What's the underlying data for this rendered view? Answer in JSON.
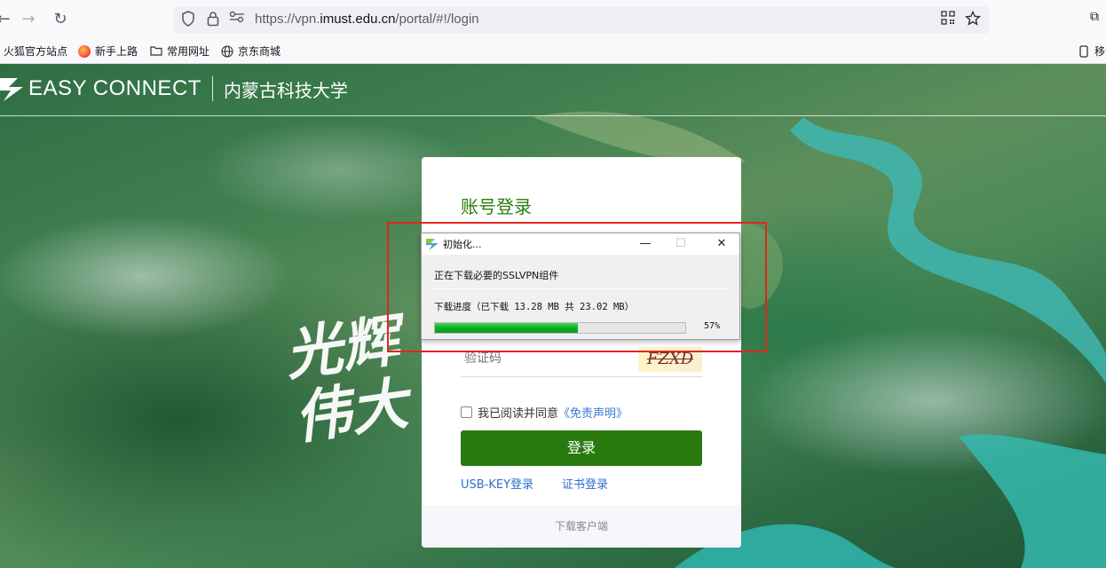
{
  "browser": {
    "url_prefix": "https://vpn.",
    "url_host": "imust.edu.cn",
    "url_suffix": "/portal/#!/login",
    "bookmarks": [
      {
        "label": "火狐官方站点"
      },
      {
        "label": "新手上路"
      },
      {
        "label": "常用网址"
      },
      {
        "label": "京东商城"
      }
    ],
    "mobile_bookmarks_label": "移动"
  },
  "header": {
    "brand": "EASY CONNECT",
    "school": "内蒙古科技大学"
  },
  "background": {
    "calligraphy": "光辉伟大"
  },
  "login": {
    "title": "账号登录",
    "captcha_placeholder": "验证码",
    "captcha_text": "FZXD",
    "agree_text": "我已阅读并同意",
    "disclaimer_link": "《免责声明》",
    "login_button": "登录",
    "usb_key_login": "USB-KEY登录",
    "cert_login": "证书登录",
    "download_client": "下载客户端",
    "brand_color": "#287a0f"
  },
  "dialog": {
    "title": "初始化...",
    "message": "正在下载必要的SSLVPN组件",
    "progress_label": "下载进度（已下载 13.28 MB  共 23.02 MB）",
    "downloaded_mb": 13.28,
    "total_mb": 23.02,
    "progress_percent": 57,
    "progress_text": "57%"
  },
  "highlight_color": "#e0261d"
}
